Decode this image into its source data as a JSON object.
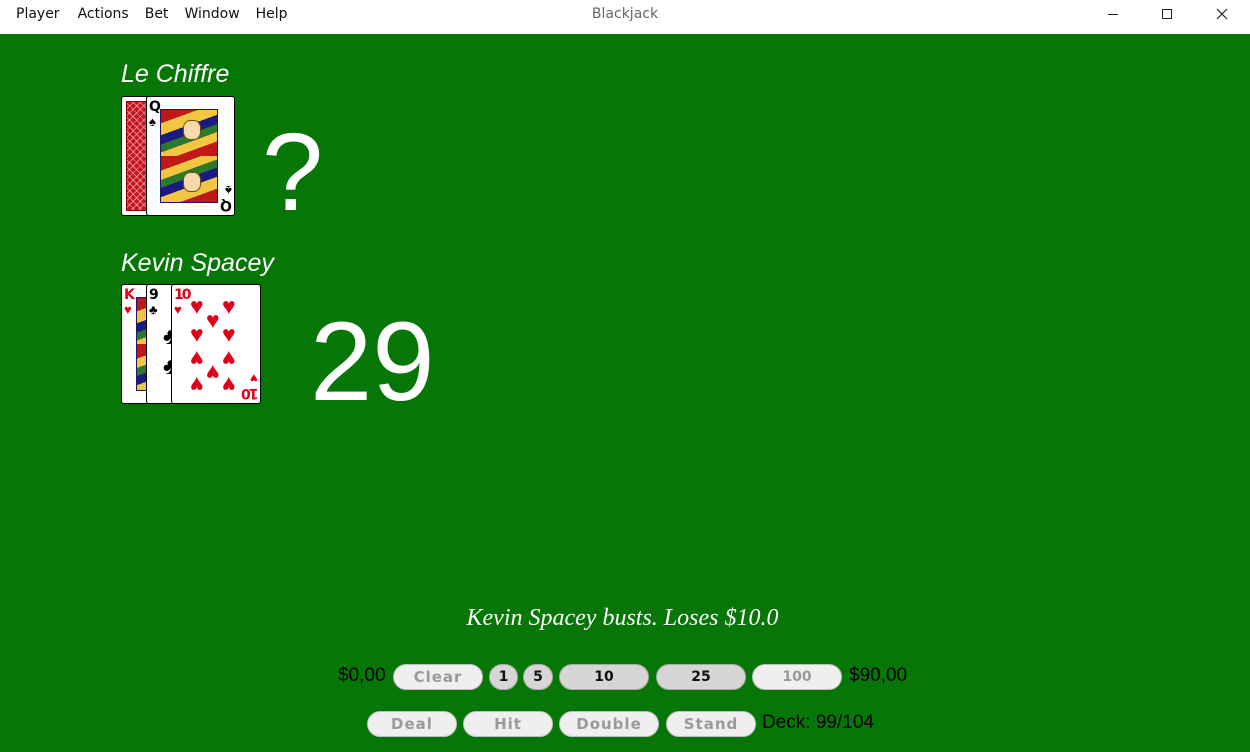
{
  "window": {
    "title": "Blackjack",
    "menu": [
      "Player",
      "Actions",
      "Bet",
      "Window",
      "Help"
    ]
  },
  "dealer": {
    "name": "Le Chiffre",
    "score": "?",
    "cards": [
      {
        "face_down": true
      },
      {
        "rank": "Q",
        "suit": "♠",
        "color": "black"
      }
    ]
  },
  "player": {
    "name": "Kevin Spacey",
    "score": "29",
    "cards": [
      {
        "rank": "K",
        "suit": "♥",
        "color": "red"
      },
      {
        "rank": "9",
        "suit": "♣",
        "color": "black"
      },
      {
        "rank": "10",
        "suit": "♥",
        "color": "red"
      }
    ]
  },
  "status_message": "Kevin Spacey busts. Loses $10.0",
  "bet_bar": {
    "current_bet": "$0,00",
    "clear_label": "Clear",
    "chips": [
      "1",
      "5",
      "10",
      "25",
      "100"
    ],
    "bankroll": "$90,00"
  },
  "action_bar": {
    "deal_label": "Deal",
    "hit_label": "Hit",
    "double_label": "Double",
    "stand_label": "Stand",
    "deck_label": "Deck:",
    "deck_value": "99/104"
  },
  "colors": {
    "felt": "#067606",
    "card_back": "#c8141e",
    "red_suit": "#e0001a"
  }
}
